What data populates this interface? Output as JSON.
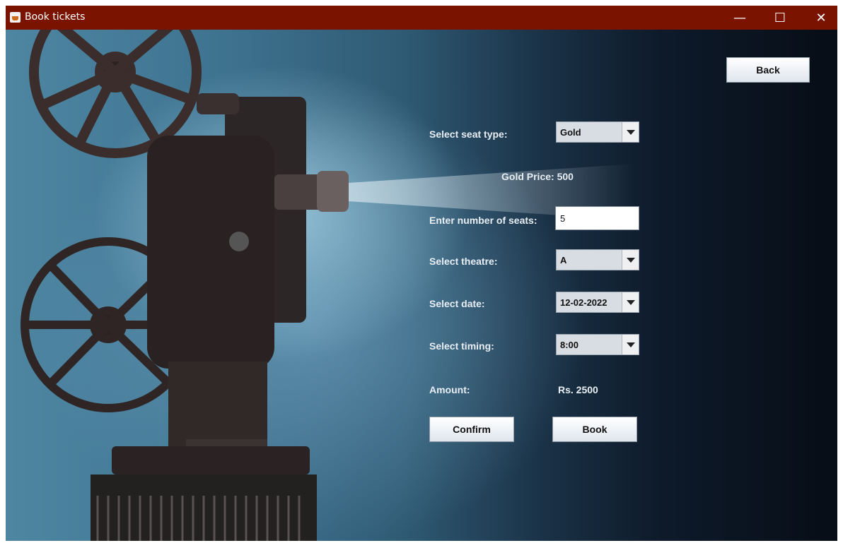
{
  "window": {
    "title": "Book tickets"
  },
  "controls": {
    "minimize": "—",
    "maximize": "☐",
    "close": "✕"
  },
  "form": {
    "seat_type_label": "Select seat type:",
    "seat_type_value": "Gold",
    "price_text": "Gold Price: 500",
    "seats_label": "Enter number of seats:",
    "seats_value": "5",
    "theatre_label": "Select theatre:",
    "theatre_value": "A",
    "date_label": "Select date:",
    "date_value": "12-02-2022",
    "timing_label": "Select timing:",
    "timing_value": "8:00",
    "amount_label": "Amount:",
    "amount_value": "Rs. 2500"
  },
  "buttons": {
    "back": "Back",
    "confirm": "Confirm",
    "book": "Book"
  },
  "colors": {
    "titlebar": "#7a1400",
    "label_text": "#e8eef3"
  }
}
